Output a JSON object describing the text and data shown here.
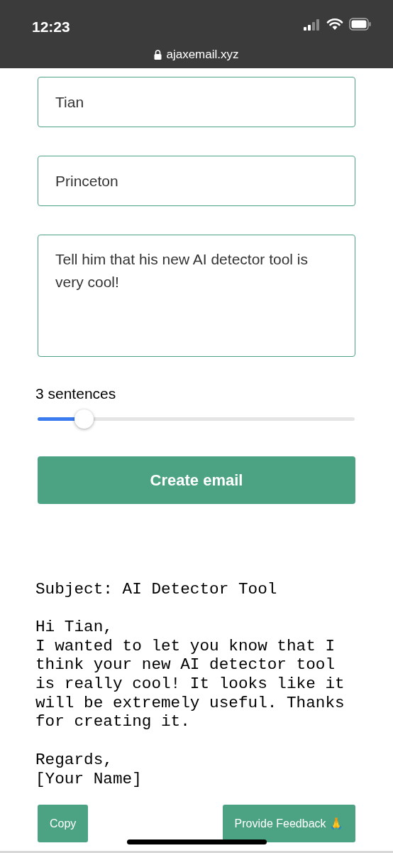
{
  "status_bar": {
    "time": "12:23",
    "url": "ajaxemail.xyz"
  },
  "fields": [
    {
      "kind": "input",
      "value": "Tian"
    },
    {
      "kind": "input",
      "value": "Princeton"
    },
    {
      "kind": "textarea",
      "value": "Tell him that his new AI detector tool is very cool!"
    }
  ],
  "slider": {
    "label": "3 sentences",
    "level": 0.145
  },
  "create_button": "Create email",
  "email": {
    "subject": "Subject: AI Detector Tool",
    "body": "Hi Tian,\nI wanted to let you know that I think your new AI detector tool is really cool! It looks like it will be extremely useful. Thanks for creating it.",
    "signoff": "Regards,\n[Your Name]"
  },
  "buttons": [
    "Copy",
    "Provide Feedback 🙏"
  ]
}
